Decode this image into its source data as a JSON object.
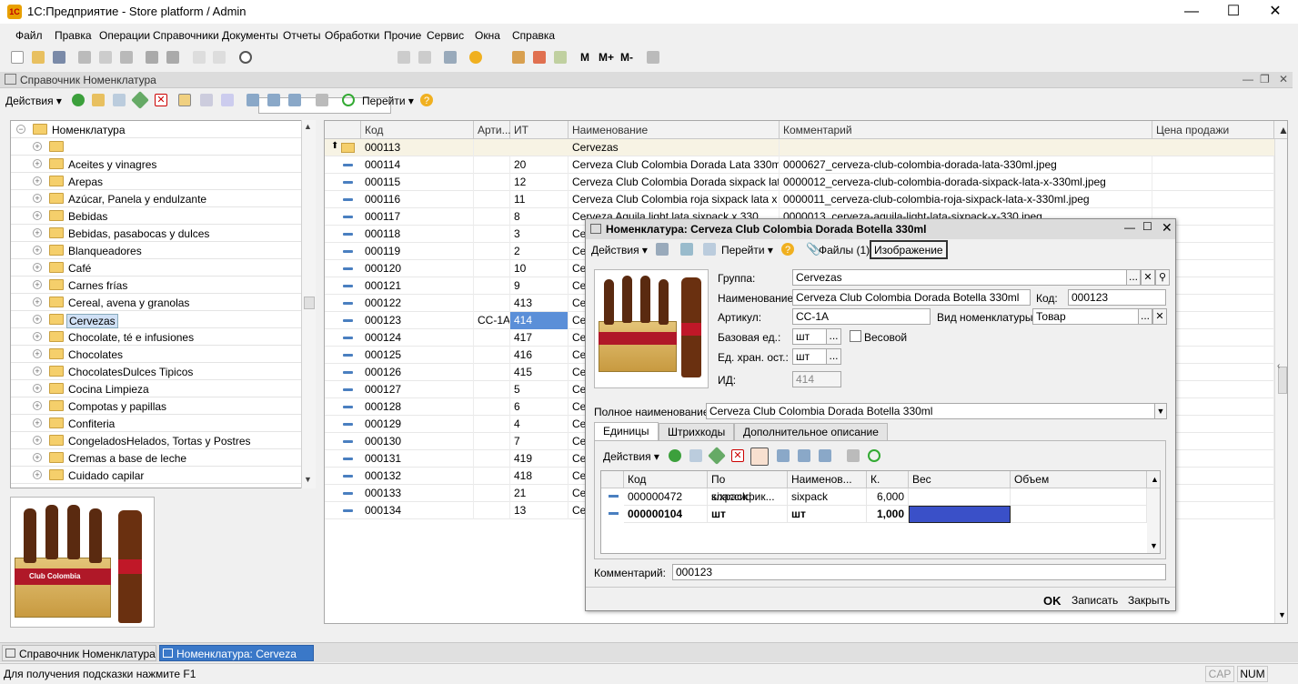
{
  "app": {
    "logo": "1С",
    "title": "1С:Предприятие - Store platform / Admin"
  },
  "menu": [
    "Файл",
    "Правка",
    "Операции",
    "Справочники",
    "Документы",
    "Отчеты",
    "Обработки",
    "Прочие",
    "Сервис",
    "Окна",
    "Справка"
  ],
  "toolbar": {
    "mem_labels": [
      "M",
      "M+",
      "M-"
    ]
  },
  "catalog": {
    "title": "Справочник Номенклатура",
    "actions_label": "Действия",
    "goto_label": "Перейти",
    "tree_root": "Номенклатура",
    "tree_items": [
      "",
      "Aceites y vinagres",
      "Arepas",
      "Azúcar, Panela y endulzante",
      "Bebidas",
      "Bebidas, pasabocas y dulces",
      "Blanqueadores",
      "Café",
      "Carnes frías",
      "Cereal, avena y granolas",
      "Cervezas",
      "Chocolate, té e infusiones",
      "Chocolates",
      "ChocolatesDulces Tipicos",
      "Cocina Limpieza",
      "Compotas y papillas",
      "Confiteria",
      "CongeladosHelados, Tortas y Postres",
      "Cremas a base de leche",
      "Cuidado capilar"
    ],
    "selected_tree_item": "Cervezas",
    "grid": {
      "headers": [
        "Код",
        "Арти...",
        "ИТ",
        "Наименование",
        "Комментарий",
        "Цена продажи"
      ],
      "parent_row": {
        "code": "000113",
        "name": "Cervezas"
      },
      "rows": [
        {
          "code": "000114",
          "art": "",
          "it": "20",
          "name": "Cerveza  Club Colombia Dorada Lata 330ml",
          "comment": "0000627_cerveza-club-colombia-dorada-lata-330ml.jpeg"
        },
        {
          "code": "000115",
          "art": "",
          "it": "12",
          "name": "Cerveza  Club Colombia Dorada sixpack lata x...",
          "comment": "0000012_cerveza-club-colombia-dorada-sixpack-lata-x-330ml.jpeg"
        },
        {
          "code": "000116",
          "art": "",
          "it": "11",
          "name": "Cerveza  Club Colombia roja sixpack lata x 33...",
          "comment": "0000011_cerveza-club-colombia-roja-sixpack-lata-x-330ml.jpeg"
        },
        {
          "code": "000117",
          "art": "",
          "it": "8",
          "name": "Cerveza Aguila light  lata sixpack x 330",
          "comment": "0000013_cerveza-aguila-light-lata-sixpack-x-330.jpeg"
        },
        {
          "code": "000118",
          "art": "",
          "it": "3",
          "name": "Ce",
          "comment": ""
        },
        {
          "code": "000119",
          "art": "",
          "it": "2",
          "name": "Ce",
          "comment": ""
        },
        {
          "code": "000120",
          "art": "",
          "it": "10",
          "name": "Ce",
          "comment": ""
        },
        {
          "code": "000121",
          "art": "",
          "it": "9",
          "name": "Ce",
          "comment": ""
        },
        {
          "code": "000122",
          "art": "",
          "it": "413",
          "name": "Ce",
          "comment": ""
        },
        {
          "code": "000123",
          "art": "CC-1A",
          "it": "414",
          "name": "Ce",
          "comment": ""
        },
        {
          "code": "000124",
          "art": "",
          "it": "417",
          "name": "Ce",
          "comment": ""
        },
        {
          "code": "000125",
          "art": "",
          "it": "416",
          "name": "Ce",
          "comment": ""
        },
        {
          "code": "000126",
          "art": "",
          "it": "415",
          "name": "Ce",
          "comment": ""
        },
        {
          "code": "000127",
          "art": "",
          "it": "5",
          "name": "Ce",
          "comment": ""
        },
        {
          "code": "000128",
          "art": "",
          "it": "6",
          "name": "Ce",
          "comment": ""
        },
        {
          "code": "000129",
          "art": "",
          "it": "4",
          "name": "Ce",
          "comment": ""
        },
        {
          "code": "000130",
          "art": "",
          "it": "7",
          "name": "Ce",
          "comment": ""
        },
        {
          "code": "000131",
          "art": "",
          "it": "419",
          "name": "Ce",
          "comment": ""
        },
        {
          "code": "000132",
          "art": "",
          "it": "418",
          "name": "Ce",
          "comment": ""
        },
        {
          "code": "000133",
          "art": "",
          "it": "21",
          "name": "Ce",
          "comment": ""
        },
        {
          "code": "000134",
          "art": "",
          "it": "13",
          "name": "Ce",
          "comment": ""
        }
      ]
    }
  },
  "dialog": {
    "title": "Номенклатура: Cerveza Club Colombia Dorada Botella 330ml",
    "actions_label": "Действия",
    "goto_label": "Перейти",
    "files_label": "Файлы (1)",
    "image_label": "Изображение",
    "group_label": "Группа:",
    "group_value": "Cervezas",
    "name_label": "Наименование:",
    "name_value": "Cerveza Club Colombia Dorada Botella 330ml",
    "code_label": "Код:",
    "code_value": "000123",
    "article_label": "Артикул:",
    "article_value": "CC-1A",
    "kind_label": "Вид номенклатуры:",
    "kind_value": "Товар",
    "base_unit_label": "Базовая ед.:",
    "base_unit_value": "шт",
    "weight_label": "Весовой",
    "storage_unit_label": "Ед. хран. ост.:",
    "storage_unit_value": "шт",
    "id_label": "ИД:",
    "id_value": "414",
    "full_name_label": "Полное наименование:",
    "full_name_value": "Cerveza Club Colombia Dorada Botella 330ml",
    "tabs": [
      "Единицы",
      "Штрихкоды",
      "Дополнительное описание"
    ],
    "units_actions_label": "Действия",
    "units_headers": [
      "Код",
      "По классифик...",
      "Наименов...",
      "К.",
      "Вес",
      "Объем"
    ],
    "units_rows": [
      {
        "code": "000000472",
        "classifier": "sixpack",
        "name": "sixpack",
        "k": "6,000",
        "weight": "",
        "volume": ""
      },
      {
        "code": "000000104",
        "classifier": "шт",
        "name": "шт",
        "k": "1,000",
        "weight": "",
        "volume": ""
      }
    ],
    "comment_label": "Комментарий:",
    "comment_value": "000123",
    "ok_label": "OK",
    "save_label": "Записать",
    "close_label": "Закрыть"
  },
  "preview": {
    "brand": "Club Colombia"
  },
  "taskbar": [
    "Справочник Номенклатура",
    "Номенклатура: Cerveza Club..."
  ],
  "status": {
    "hint": "Для получения подсказки нажмите F1",
    "cap": "CAP",
    "num": "NUM"
  }
}
